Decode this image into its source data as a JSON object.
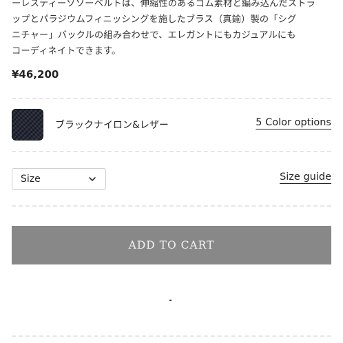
{
  "description": {
    "lines": [
      "ーレスティーゾソーベルトは、伸縮性のあるゴム素材と編み込んだストラ",
      "ップとパラジウムフィニッシングを施したブラス（真鍮）製の「シグ",
      "ニチャー」バックルの組み合わせで、エレガントにもカジュアルにも",
      "コーディネイトできます。"
    ]
  },
  "price": "¥46,200",
  "variant": {
    "swatch_icon": "black-nylon-texture",
    "name": "ブラックナイロン&レザー",
    "color_options_label": "5 Color options"
  },
  "size": {
    "select_label": "Size",
    "chevron_icon": "chevron-down",
    "guide_label": "Size guide"
  },
  "cart": {
    "button_label": "ADD TO CART",
    "button_color": "#888888"
  }
}
